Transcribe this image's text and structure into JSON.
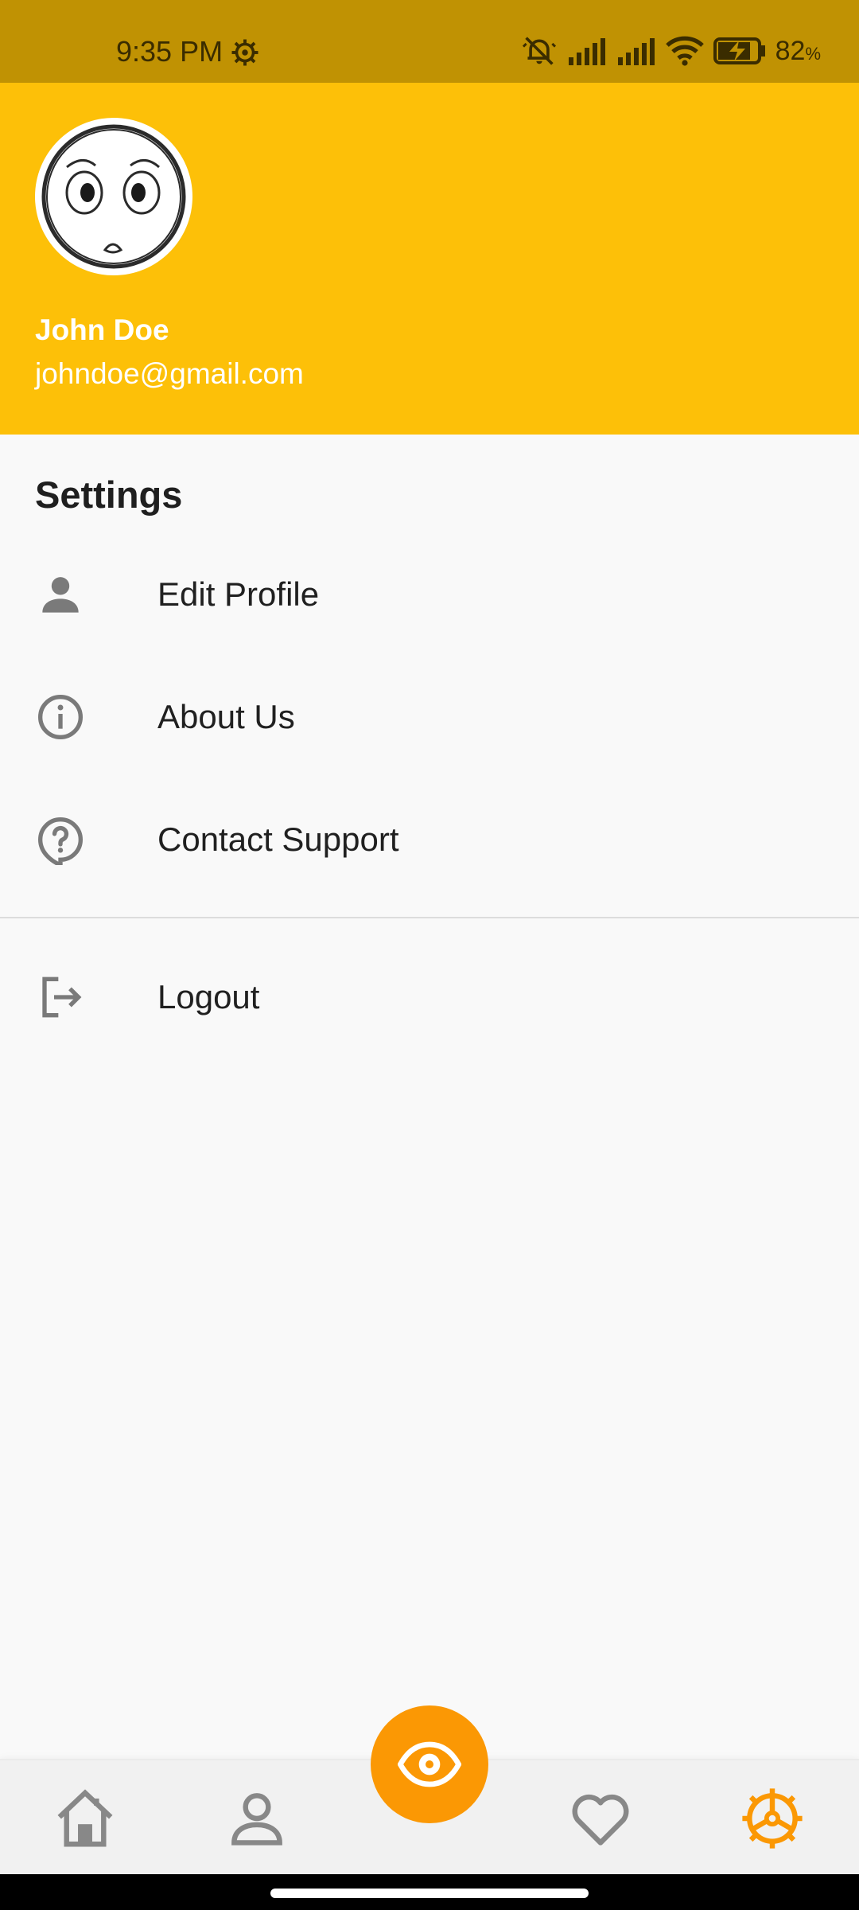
{
  "status_bar": {
    "time": "9:35 PM",
    "battery_percent": "82",
    "battery_unit": "%"
  },
  "header": {
    "user_name": "John Doe",
    "user_email": "johndoe@gmail.com"
  },
  "settings": {
    "title": "Settings",
    "items": [
      {
        "label": "Edit Profile",
        "icon": "person-icon"
      },
      {
        "label": "About Us",
        "icon": "info-icon"
      },
      {
        "label": "Contact Support",
        "icon": "help-bubble-icon"
      }
    ],
    "logout": {
      "label": "Logout",
      "icon": "logout-icon"
    }
  },
  "bottom_nav": {
    "items": [
      "home-icon",
      "profile-icon",
      "favorites-icon",
      "settings-icon"
    ],
    "fab_icon": "eye-icon",
    "active": "settings-icon"
  },
  "colors": {
    "status_bar": "#c09203",
    "header": "#fdc008",
    "accent": "#fb9804",
    "icon_grey": "#7a7a7a"
  }
}
